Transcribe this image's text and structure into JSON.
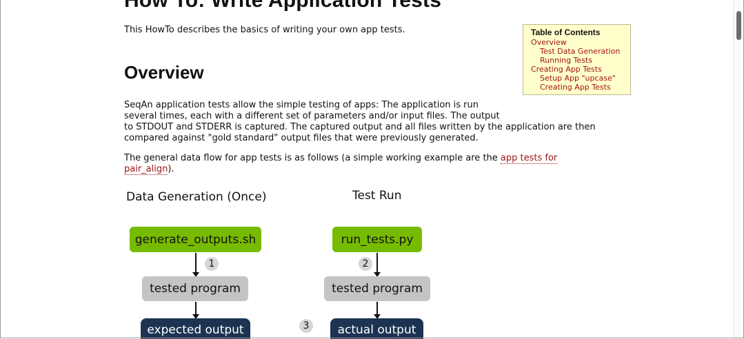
{
  "page": {
    "title": "How To: Write Application Tests",
    "intro": "This HowTo describes the basics of writing your own app tests.",
    "section_heading": "Overview",
    "paragraph1_lines": [
      "SeqAn application tests allow the simple testing of apps: The application is run",
      "several times, each with a different set of parameters and/or input files. The output",
      "to STDOUT and STDERR is captured. The captured output and all files written by the application are then",
      "compared against \"gold standard\" output files that were previously generated."
    ],
    "paragraph2_before": "The general data flow for app tests is as follows (a simple working example are the ",
    "paragraph2_link_line1": "app tests for",
    "paragraph2_link_line2": "pair_align",
    "paragraph2_after": ")."
  },
  "toc": {
    "title": "Table of Contents",
    "items": [
      {
        "label": "Overview",
        "level": 1
      },
      {
        "label": "Test Data Generation",
        "level": 2
      },
      {
        "label": "Running Tests",
        "level": 2
      },
      {
        "label": "Creating App Tests",
        "level": 1
      },
      {
        "label": "Setup App \"upcase\"",
        "level": 2
      },
      {
        "label": "Creating App Tests",
        "level": 2
      }
    ]
  },
  "diagram": {
    "left_title": "Data Generation (Once)",
    "right_title": "Test Run",
    "left_script": "generate_outputs.sh",
    "right_script": "run_tests.py",
    "left_program": "tested program",
    "right_program": "tested program",
    "left_output": "expected output",
    "right_output": "actual output",
    "step1": "1",
    "step2": "2",
    "step3": "3",
    "colors": {
      "script": "#77bb00",
      "program": "#c4c4c4",
      "output": "#1c3452"
    }
  }
}
